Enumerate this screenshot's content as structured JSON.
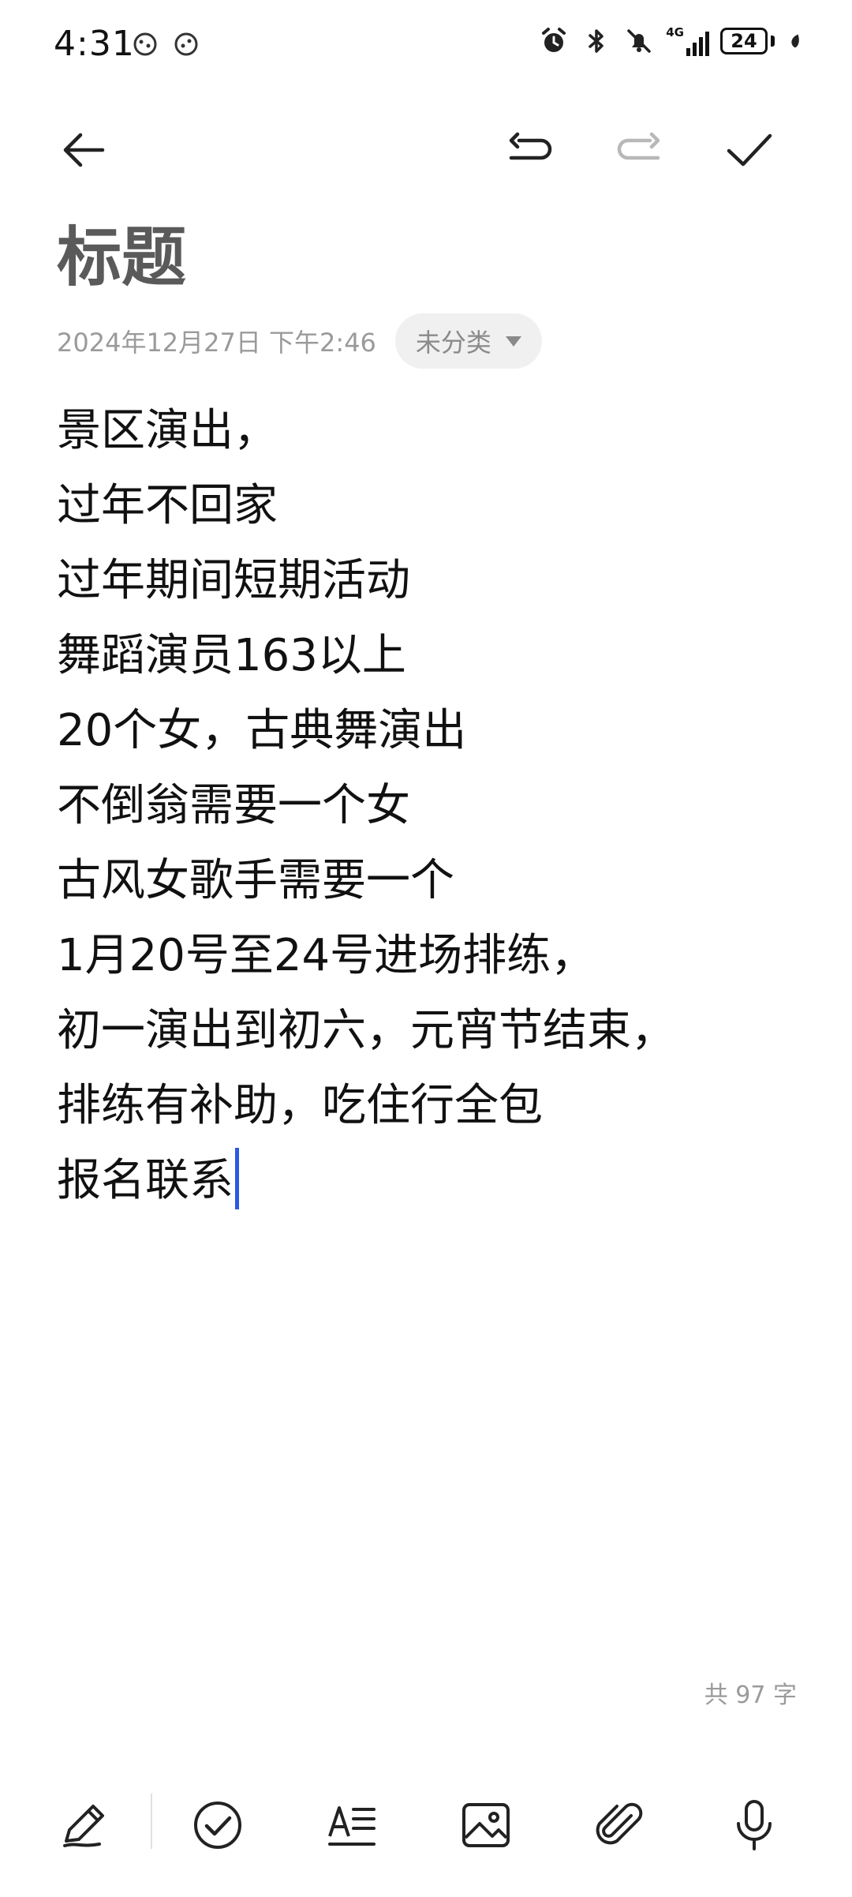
{
  "status_bar": {
    "time": "4:31",
    "network": "4G",
    "battery": "24"
  },
  "toolbar": {
    "back_icon": "arrow-left-icon",
    "undo_icon": "undo-icon",
    "redo_icon": "redo-icon",
    "confirm_icon": "checkmark-icon"
  },
  "note": {
    "title": "标题",
    "date": "2024年12月27日 下午2:46",
    "category": "未分类",
    "lines": [
      "景区演出，",
      "过年不回家",
      "过年期间短期活动",
      "舞蹈演员163以上",
      "20个女，古典舞演出",
      "不倒翁需要一个女",
      "古风女歌手需要一个",
      "1月20号至24号进场排练，",
      "初一演出到初六，元宵节结束，",
      "排练有补助，吃住行全包",
      "报名联系"
    ],
    "word_count": "共 97 字"
  },
  "bottom_toolbar": {
    "items": [
      "pen-icon",
      "checklist-icon",
      "text-format-icon",
      "image-icon",
      "attachment-icon",
      "microphone-icon"
    ]
  },
  "colors": {
    "caret": "#2b5ae0",
    "title": "#5a5a5a",
    "meta": "#9a9a9a"
  }
}
